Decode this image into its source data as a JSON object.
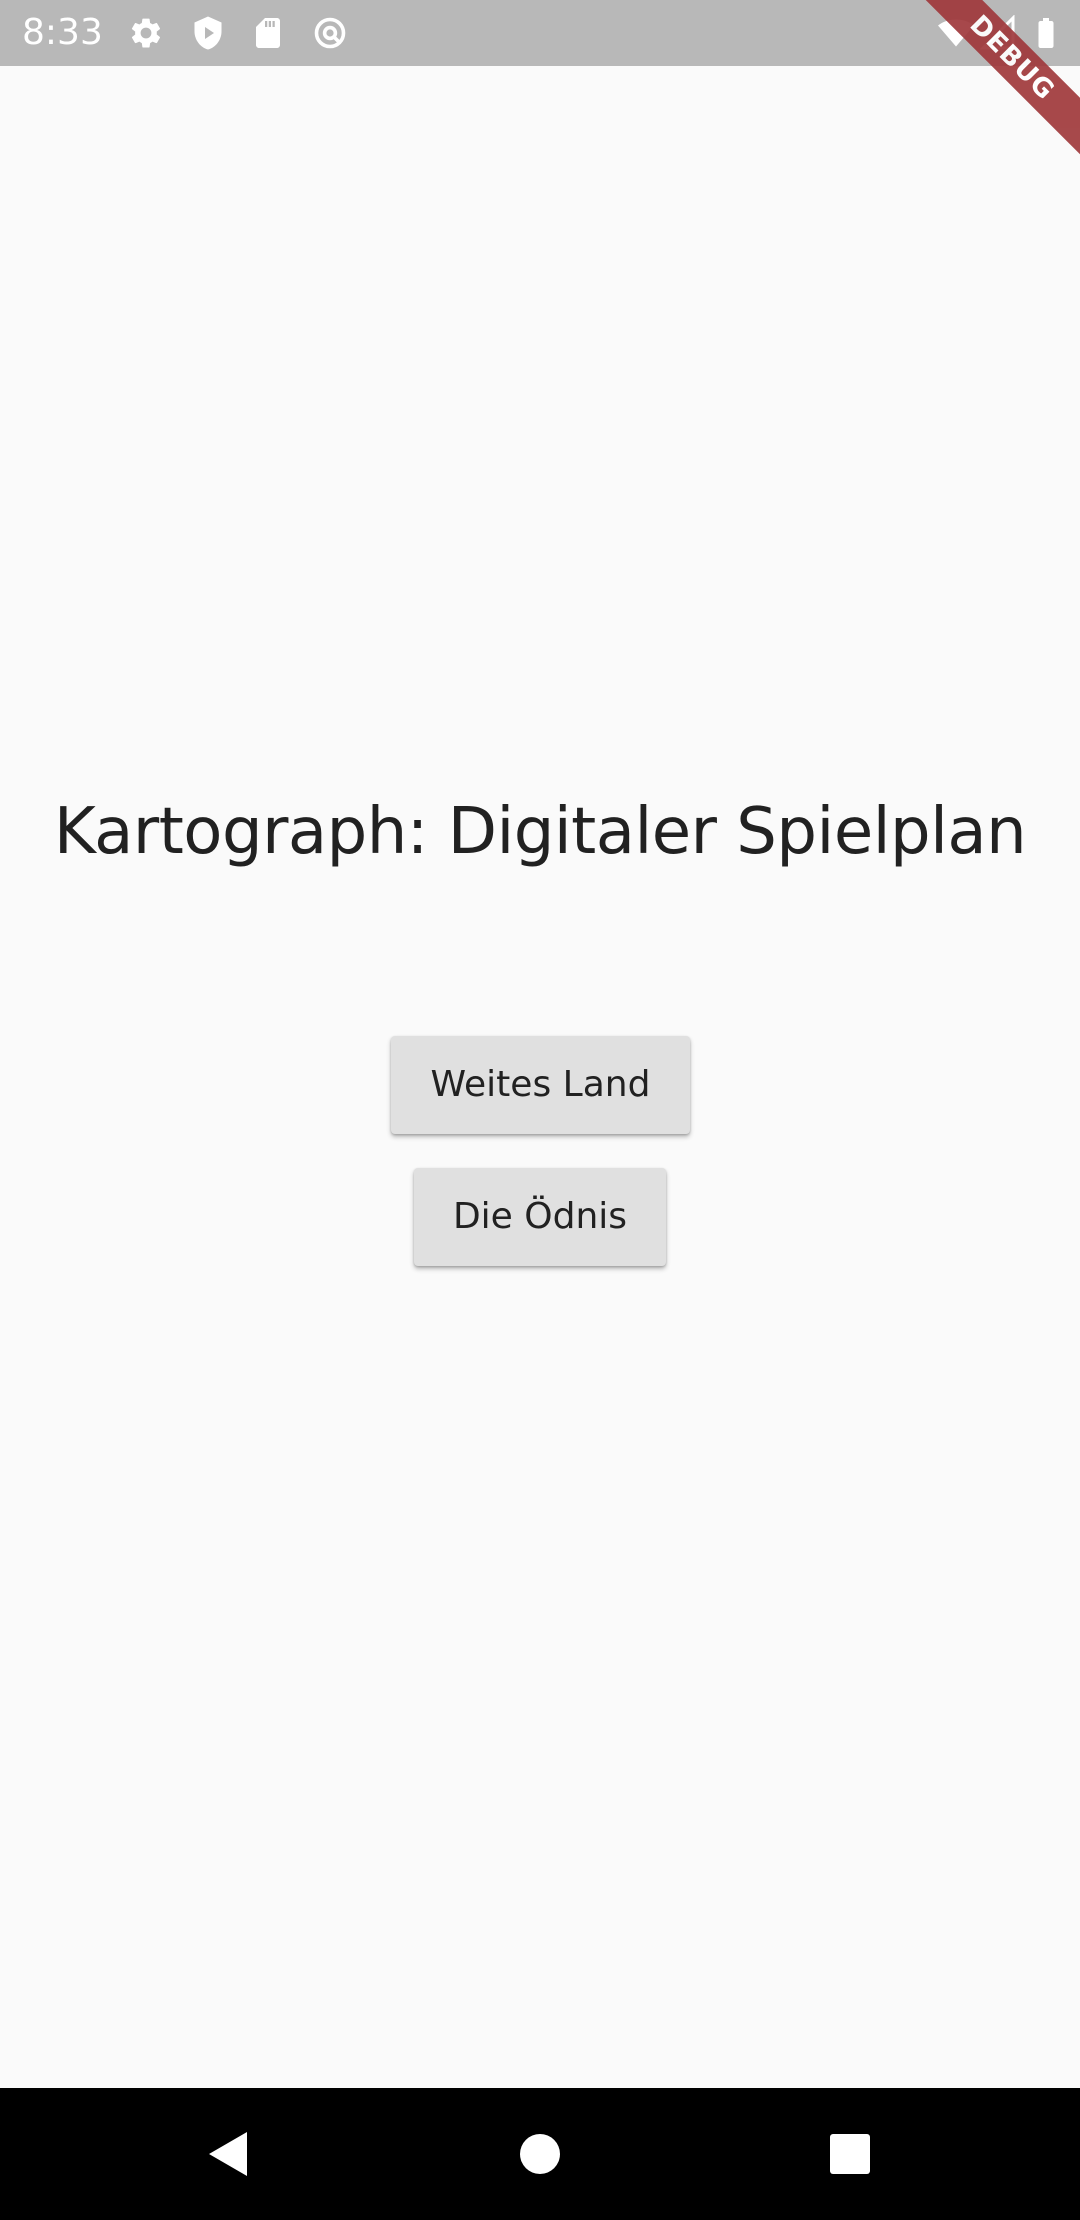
{
  "status_bar": {
    "time": "8:33",
    "left_icons": [
      "settings-icon",
      "shield-play-icon",
      "sd-card-icon",
      "at-sign-icon"
    ],
    "right_icons": [
      "wifi-icon",
      "cell-signal-icon",
      "battery-icon"
    ]
  },
  "debug_banner": {
    "label": "DEBUG",
    "color": "#a0393c"
  },
  "main": {
    "title": "Kartograph: Digitaler Spielplan",
    "buttons": {
      "weites_land": "Weites Land",
      "die_oednis": "Die Ödnis"
    }
  },
  "nav_bar": {
    "icons": [
      "back-icon",
      "home-icon",
      "recents-icon"
    ]
  },
  "colors": {
    "background": "#fafafa",
    "status_bar": "#b8b8b8",
    "button": "#e0e0e0",
    "text": "#212121",
    "nav_bar": "#000000"
  }
}
